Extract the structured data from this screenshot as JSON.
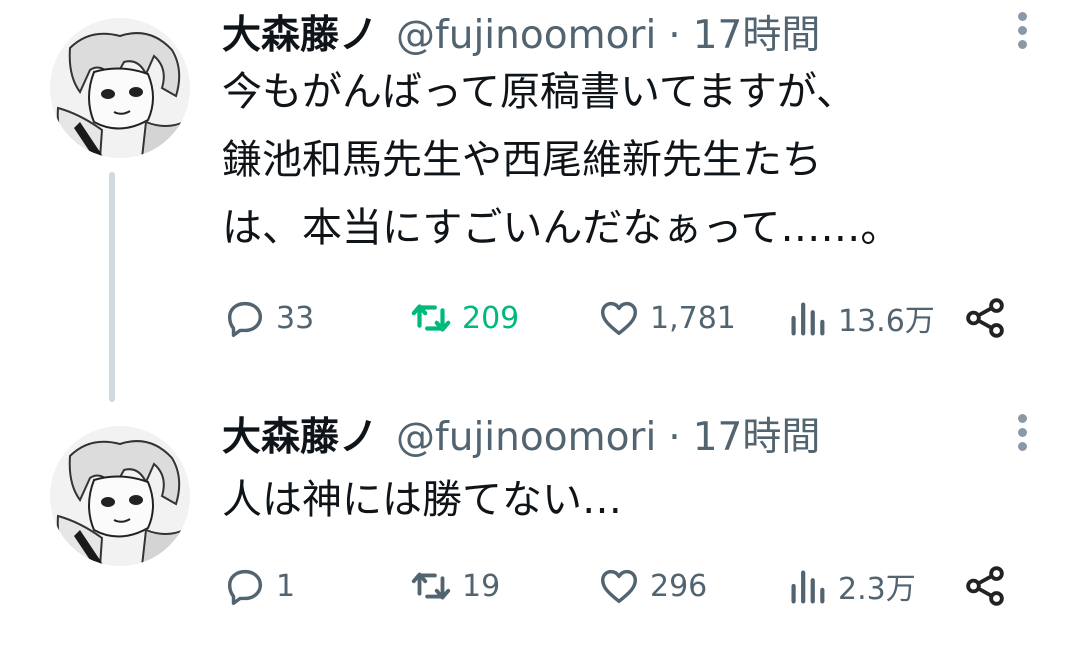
{
  "colors": {
    "accent_retweet": "#00ba7c",
    "secondary_text": "#536471",
    "thread_line": "#cfd9de"
  },
  "tweets": [
    {
      "author": {
        "name": "大森藤ノ",
        "handle": "@fujinoomori"
      },
      "separator": "·",
      "time": "17時間",
      "text_lines": [
        "今もがんばって原稿書いてますが、",
        "鎌池和馬先生や西尾維新先生たち",
        "は、本当にすごいんだなぁって……。"
      ],
      "metrics": {
        "replies": "33",
        "retweets": "209",
        "likes": "1,781",
        "views": "13.6万"
      },
      "retweeted": true,
      "icons": [
        "more-icon",
        "reply-icon",
        "retweet-icon",
        "like-icon",
        "views-icon",
        "share-icon"
      ]
    },
    {
      "author": {
        "name": "大森藤ノ",
        "handle": "@fujinoomori"
      },
      "separator": "·",
      "time": "17時間",
      "text_lines": [
        "人は神には勝てない…"
      ],
      "metrics": {
        "replies": "1",
        "retweets": "19",
        "likes": "296",
        "views": "2.3万"
      },
      "retweeted": false,
      "icons": [
        "more-icon",
        "reply-icon",
        "retweet-icon",
        "like-icon",
        "views-icon",
        "share-icon"
      ]
    }
  ]
}
